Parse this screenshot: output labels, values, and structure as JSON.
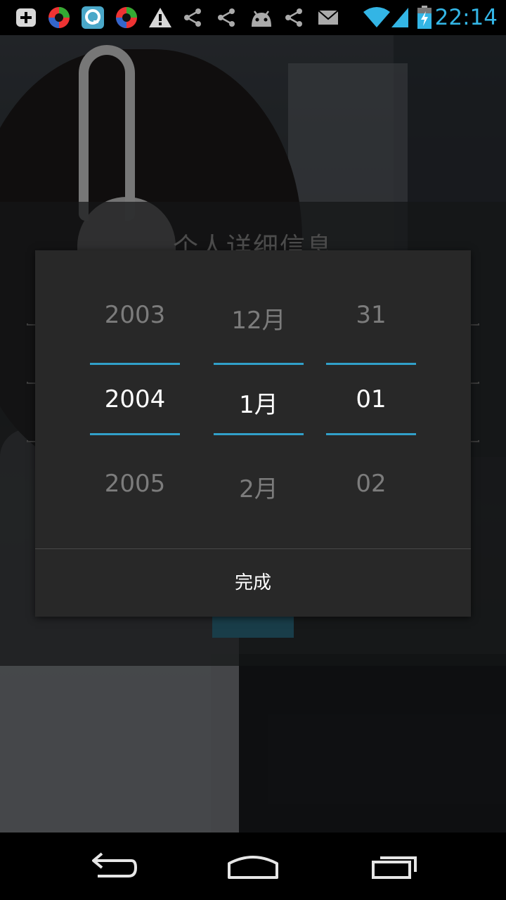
{
  "status_bar": {
    "time": "22:14",
    "left_icons": [
      "add-box-icon",
      "app-circle-icon",
      "app-q-icon",
      "app-circle-icon",
      "warning-icon",
      "share-icon",
      "share-icon",
      "android-icon",
      "share-icon",
      "email-icon"
    ],
    "right_icons": [
      "wifi-icon",
      "signal-icon",
      "battery-charging-icon"
    ],
    "accent_color": "#33b5e5"
  },
  "background_page": {
    "title": "个人详细信息"
  },
  "date_picker": {
    "year": {
      "prev": "2003",
      "current": "2004",
      "next": "2005"
    },
    "month": {
      "prev": "12月",
      "current": "1月",
      "next": "2月"
    },
    "day": {
      "prev": "31",
      "current": "01",
      "next": "02"
    },
    "done_label": "完成",
    "accent_color": "#33b5e5"
  },
  "nav_bar": {
    "buttons": [
      "back-icon",
      "home-icon",
      "recent-apps-icon"
    ]
  }
}
